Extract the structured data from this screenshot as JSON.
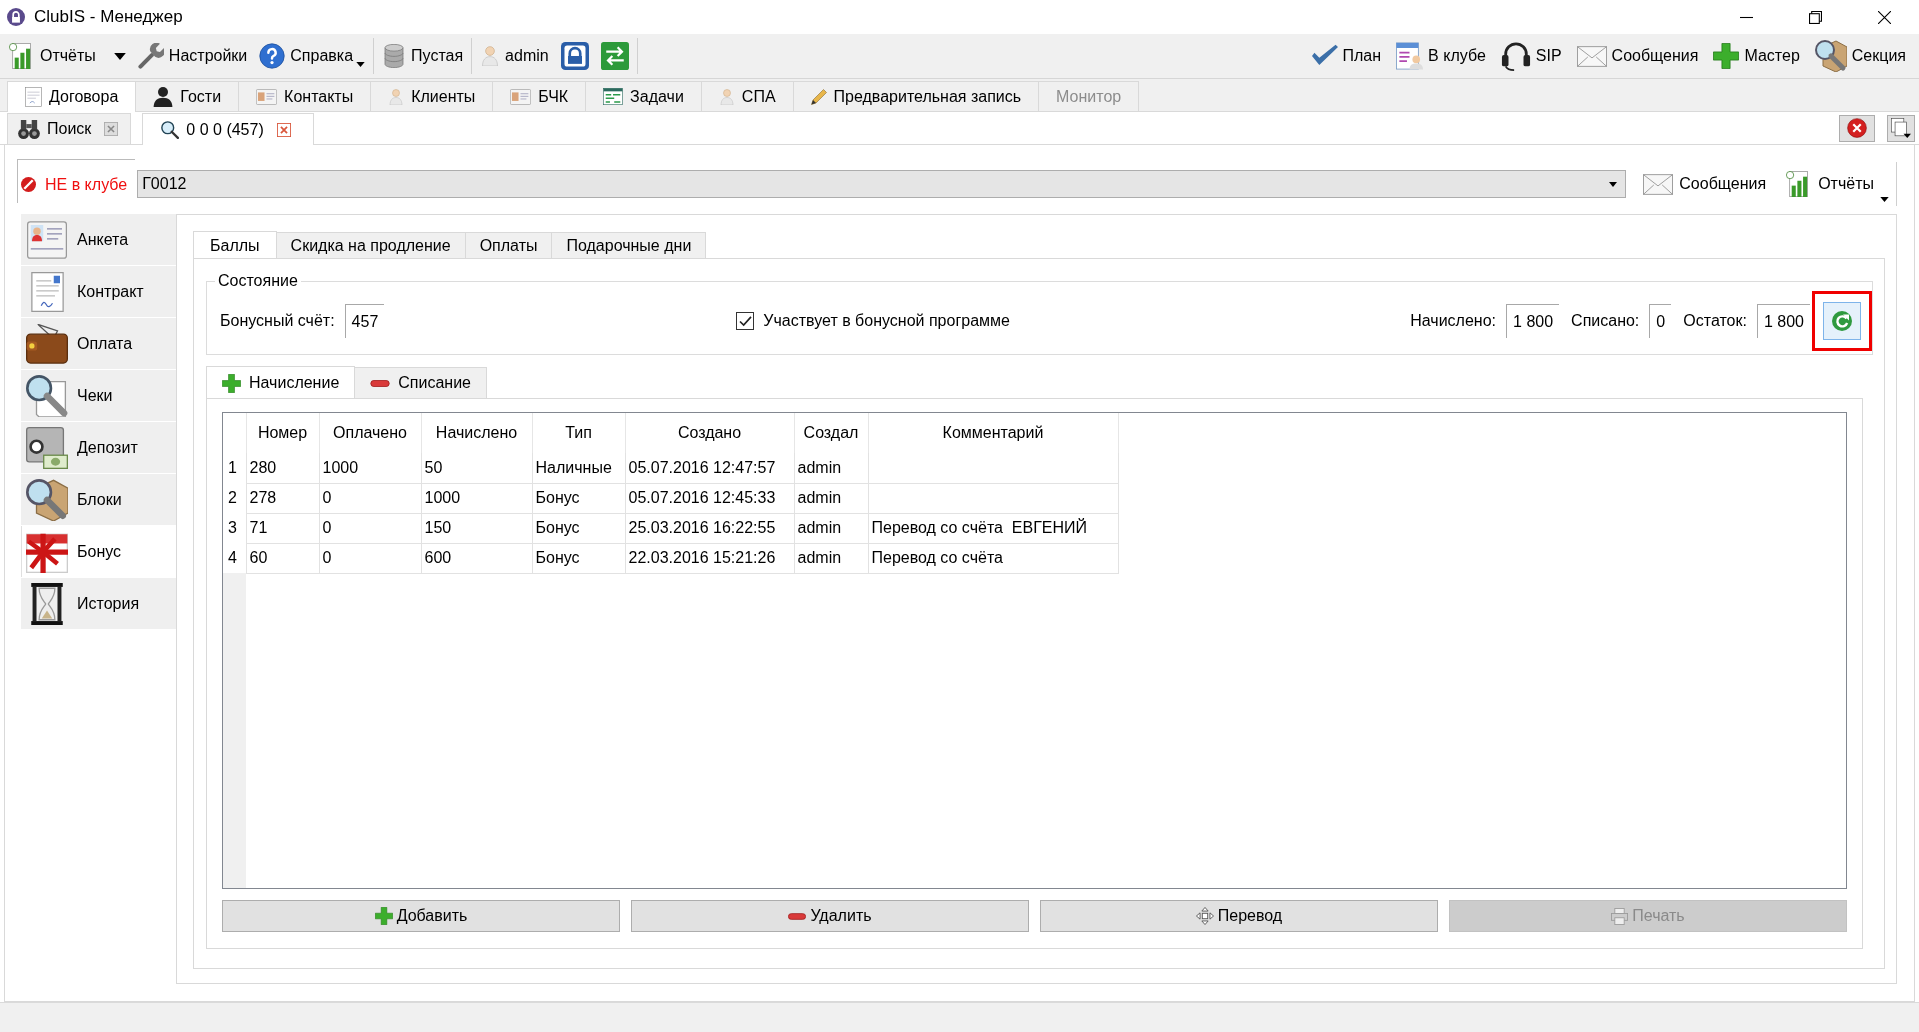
{
  "window": {
    "title": "ClubIS - Менеджер"
  },
  "toolbar": {
    "left_groups": [
      [
        {
          "kind": "split",
          "label": "Отчёты"
        },
        {
          "kind": "button",
          "label": "Настройки"
        },
        {
          "kind": "menu",
          "label": "Справка"
        }
      ],
      [
        {
          "kind": "button",
          "label": "Пустая"
        }
      ],
      [
        {
          "kind": "button",
          "label": "admin"
        },
        {
          "kind": "icon"
        },
        {
          "kind": "icon"
        }
      ]
    ],
    "right": [
      {
        "kind": "button",
        "label": "План"
      },
      {
        "kind": "button",
        "label": "В клубе"
      },
      {
        "kind": "button",
        "label": "SIP"
      },
      {
        "kind": "button",
        "label": "Сообщения"
      },
      {
        "kind": "button",
        "label": "Мастер"
      },
      {
        "kind": "button",
        "label": "Секция"
      }
    ]
  },
  "main_tabs": [
    {
      "label": "Договора",
      "selected": true,
      "disabled": false
    },
    {
      "label": "Гости",
      "selected": false,
      "disabled": false
    },
    {
      "label": "Контакты",
      "selected": false,
      "disabled": false
    },
    {
      "label": "Клиенты",
      "selected": false,
      "disabled": false
    },
    {
      "label": "БЧК",
      "selected": false,
      "disabled": false
    },
    {
      "label": "Задачи",
      "selected": false,
      "disabled": false
    },
    {
      "label": "СПА",
      "selected": false,
      "disabled": false
    },
    {
      "label": "Предварительная запись",
      "selected": false,
      "disabled": false
    },
    {
      "label": "Монитор",
      "selected": false,
      "disabled": true
    }
  ],
  "document_tabs": [
    {
      "label": "Поиск",
      "selected": false
    },
    {
      "label": "0 0 0 (457)",
      "selected": true
    }
  ],
  "client": {
    "status": {
      "label": "НЕ в клубе",
      "in_club": false
    },
    "card": "Г0012",
    "buttons": [
      {
        "kind": "button",
        "label": "Сообщения"
      },
      {
        "kind": "menu",
        "label": "Отчёты"
      }
    ]
  },
  "sidebar": {
    "items": [
      {
        "label": "Анкета",
        "selected": false
      },
      {
        "label": "Контракт",
        "selected": false
      },
      {
        "label": "Оплата",
        "selected": false
      },
      {
        "label": "Чеки",
        "selected": false
      },
      {
        "label": "Депозит",
        "selected": false
      },
      {
        "label": "Блоки",
        "selected": false
      },
      {
        "label": "Бонус",
        "selected": true
      },
      {
        "label": "История",
        "selected": false
      }
    ]
  },
  "section_tabs": [
    {
      "label": "Баллы",
      "selected": true
    },
    {
      "label": "Скидка на продление",
      "selected": false
    },
    {
      "label": "Оплаты",
      "selected": false
    },
    {
      "label": "Подарочные дни",
      "selected": false
    }
  ],
  "status_group": {
    "title": "Состояние",
    "account": {
      "label": "Бонусный счёт:",
      "value": "457"
    },
    "participation": {
      "label": "Участвует в бонусной программе",
      "checked": true
    },
    "totals": [
      {
        "label": "Начислено:",
        "value": "1 800"
      },
      {
        "label": "Списано:",
        "value": "0"
      },
      {
        "label": "Остаток:",
        "value": "1 800"
      }
    ],
    "refresh": {
      "highlighted": true
    }
  },
  "operation_tabs": [
    {
      "label": "Начисление",
      "selected": true
    },
    {
      "label": "Списание",
      "selected": false
    }
  ],
  "table": {
    "columns": [
      "Номер",
      "Оплачено",
      "Начислено",
      "Тип",
      "Создано",
      "Создал",
      "Комментарий"
    ],
    "rows": [
      {
        "row": "1",
        "cells": [
          "280",
          "1000",
          "50",
          "Наличные",
          "05.07.2016 12:47:57",
          "admin"
        ]
      },
      {
        "row": "2",
        "cells": [
          "278",
          "0",
          "1000",
          "Бонус",
          "05.07.2016 12:45:33",
          "admin"
        ]
      },
      {
        "row": "3",
        "cells": [
          "71",
          "0",
          "150",
          "Бонус",
          "25.03.2016 16:22:55",
          "admin",
          "Перевод со счёта  ЕВГЕНИЙ"
        ]
      },
      {
        "row": "4",
        "cells": [
          "60",
          "0",
          "600",
          "Бонус",
          "22.03.2016 15:21:26",
          "admin",
          "Перевод со счёта"
        ]
      }
    ]
  },
  "actions": [
    {
      "label": "Добавить",
      "disabled": false
    },
    {
      "label": "Удалить",
      "disabled": false
    },
    {
      "label": "Перевод",
      "disabled": false
    },
    {
      "label": "Печать",
      "disabled": true
    }
  ]
}
